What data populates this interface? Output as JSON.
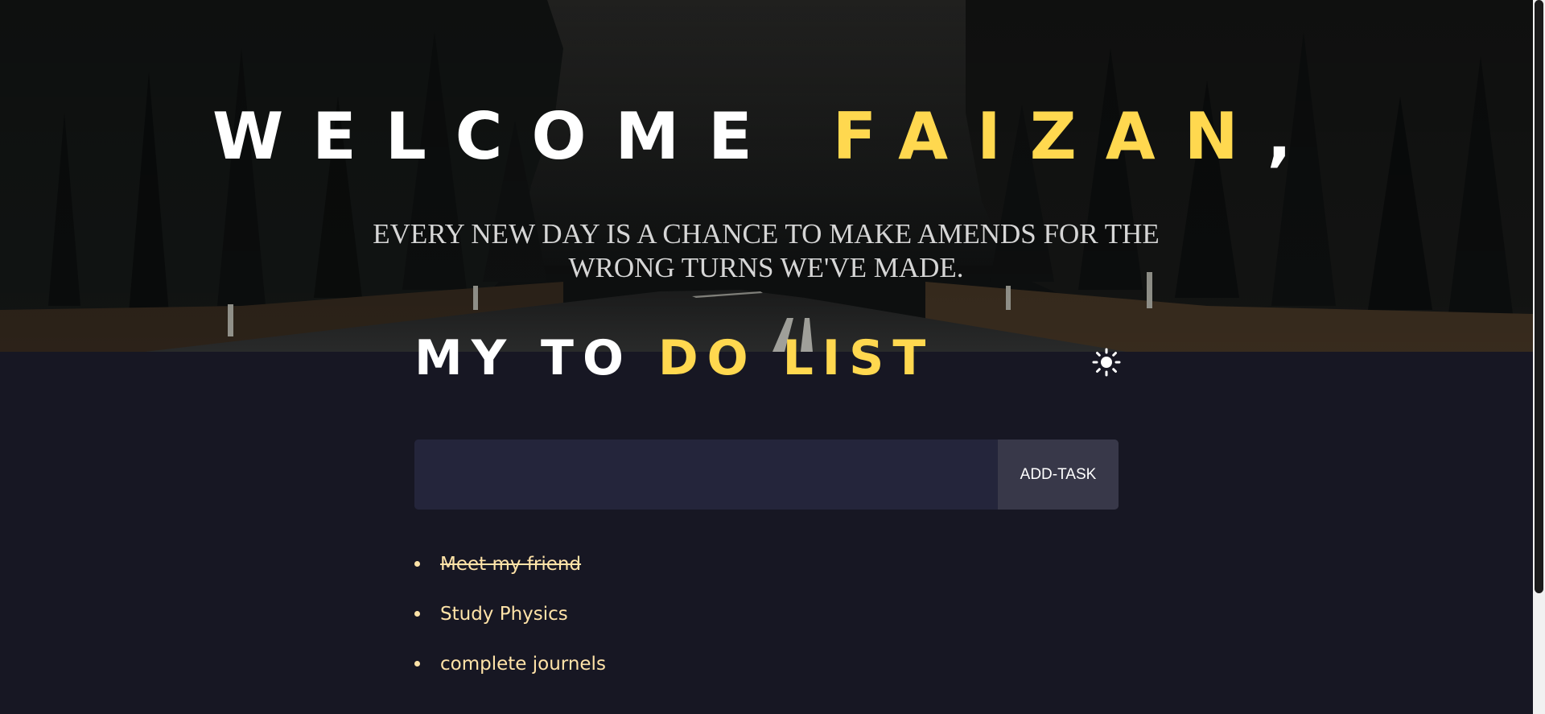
{
  "hero": {
    "title_prefix": "WELCOME ",
    "title_name": "FAIZAN",
    "title_suffix": ",",
    "quote": "Every new day is a chance to make amends for the wrong turns we've made."
  },
  "todo": {
    "title_part1": "MY TO ",
    "title_part2": "DO LIST",
    "theme_icon": "sun-icon",
    "input_value": "",
    "input_placeholder": "",
    "add_button_label": "ADD-TASK",
    "tasks": [
      {
        "text": "Meet my friend",
        "completed": true
      },
      {
        "text": "Study Physics",
        "completed": false
      },
      {
        "text": "complete journels",
        "completed": false
      }
    ]
  },
  "colors": {
    "accent": "#ffd84f",
    "background": "#171723",
    "input_background": "#24253b",
    "button_background": "#383849",
    "task_text": "#ffe3a8"
  }
}
